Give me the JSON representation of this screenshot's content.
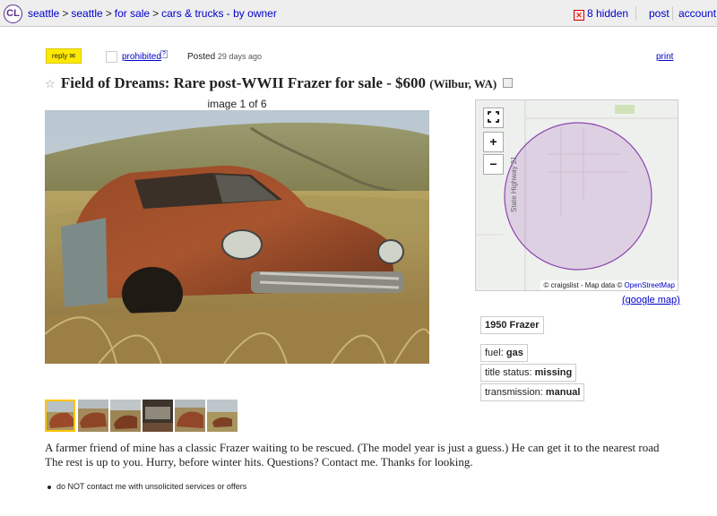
{
  "header": {
    "logo": "CL",
    "breadcrumbs": [
      "seattle",
      "seattle",
      "for sale",
      "cars & trucks - by owner"
    ],
    "breadcrumb_sep": ">",
    "hidden_count": "8 hidden",
    "post": "post",
    "account": "account"
  },
  "actions": {
    "reply": "reply ✉",
    "prohibited": "prohibited",
    "prohibited_help": "?",
    "posted_label": "Posted",
    "posted_time": "29 days ago",
    "print": "print"
  },
  "title": {
    "star": "☆",
    "text": "Field of Dreams: Rare post-WWII Frazer for sale - $600",
    "location": "(Wilbur, WA)"
  },
  "gallery": {
    "counter": "image 1 of 6",
    "thumbnail_count": 6,
    "selected_index": 0
  },
  "map": {
    "road_label": "State Highway 21",
    "attribution_prefix": "© craigslist - Map data ©",
    "attribution_link": "OpenStreetMap",
    "google_map": "(google map)",
    "zoom_in": "+",
    "zoom_out": "−",
    "fullscreen_icon": "fullscreen-icon"
  },
  "attributes": {
    "year_make": "1950 Frazer",
    "fuel_label": "fuel:",
    "fuel": "gas",
    "title_label": "title status:",
    "title_status": "missing",
    "transmission_label": "transmission:",
    "transmission": "manual"
  },
  "body": "A farmer friend of mine has a classic Frazer waiting to be rescued. (The model year is just a guess.) He can get it to the nearest road The rest is up to you. Hurry, before winter hits. Questions? Contact me. Thanks for looking.",
  "notices": [
    "do NOT contact me with unsolicited services or offers"
  ],
  "colors": {
    "link": "#0000cc",
    "reply_bg": "#ffe900",
    "map_radius": "#8e44ad"
  }
}
